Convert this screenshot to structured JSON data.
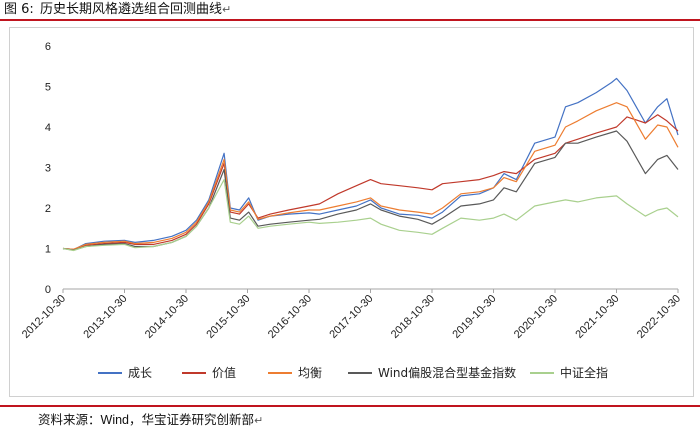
{
  "caption": {
    "label": "图 6:",
    "title": "历史长期风格遴选组合回测曲线",
    "return_mark": "↵"
  },
  "source": {
    "prefix": "资料来源：",
    "wind": "Wind",
    "sep": "，",
    "org": "华宝证券研究创新部",
    "return_mark": "↵"
  },
  "chart_data": {
    "type": "line",
    "y_ticks": [
      "0",
      "1",
      "2",
      "3",
      "4",
      "5",
      "6"
    ],
    "ylim": [
      0,
      6
    ],
    "x_ticks": [
      "2012-10-30",
      "2013-10-30",
      "2014-10-30",
      "2015-10-30",
      "2016-10-30",
      "2017-10-30",
      "2018-10-30",
      "2019-10-30",
      "2020-10-30",
      "2021-10-30",
      "2022-10-30"
    ],
    "xlim": [
      2012.83,
      2022.83
    ],
    "grid": false,
    "legend_position": "bottom",
    "series": [
      {
        "name": "成长",
        "color": "#4472c4",
        "points": [
          [
            2012.83,
            1.0
          ],
          [
            2013.0,
            0.97
          ],
          [
            2013.2,
            1.12
          ],
          [
            2013.5,
            1.18
          ],
          [
            2013.83,
            1.2
          ],
          [
            2014.0,
            1.15
          ],
          [
            2014.3,
            1.2
          ],
          [
            2014.6,
            1.3
          ],
          [
            2014.83,
            1.45
          ],
          [
            2015.0,
            1.7
          ],
          [
            2015.2,
            2.2
          ],
          [
            2015.45,
            3.35
          ],
          [
            2015.55,
            2.0
          ],
          [
            2015.7,
            1.95
          ],
          [
            2015.85,
            2.25
          ],
          [
            2016.0,
            1.7
          ],
          [
            2016.2,
            1.8
          ],
          [
            2016.5,
            1.85
          ],
          [
            2016.83,
            1.88
          ],
          [
            2017.0,
            1.85
          ],
          [
            2017.3,
            1.95
          ],
          [
            2017.6,
            2.05
          ],
          [
            2017.83,
            2.2
          ],
          [
            2018.0,
            2.0
          ],
          [
            2018.3,
            1.85
          ],
          [
            2018.6,
            1.82
          ],
          [
            2018.83,
            1.75
          ],
          [
            2019.0,
            1.9
          ],
          [
            2019.3,
            2.3
          ],
          [
            2019.6,
            2.35
          ],
          [
            2019.83,
            2.5
          ],
          [
            2020.0,
            2.85
          ],
          [
            2020.2,
            2.7
          ],
          [
            2020.5,
            3.6
          ],
          [
            2020.83,
            3.75
          ],
          [
            2021.0,
            4.5
          ],
          [
            2021.2,
            4.6
          ],
          [
            2021.5,
            4.85
          ],
          [
            2021.75,
            5.1
          ],
          [
            2021.83,
            5.2
          ],
          [
            2022.0,
            4.9
          ],
          [
            2022.3,
            4.1
          ],
          [
            2022.5,
            4.5
          ],
          [
            2022.65,
            4.7
          ],
          [
            2022.83,
            3.8
          ]
        ]
      },
      {
        "name": "价值",
        "color": "#c0392b",
        "points": [
          [
            2012.83,
            1.0
          ],
          [
            2013.0,
            0.98
          ],
          [
            2013.2,
            1.08
          ],
          [
            2013.5,
            1.12
          ],
          [
            2013.83,
            1.15
          ],
          [
            2014.0,
            1.1
          ],
          [
            2014.3,
            1.1
          ],
          [
            2014.6,
            1.2
          ],
          [
            2014.83,
            1.35
          ],
          [
            2015.0,
            1.6
          ],
          [
            2015.2,
            2.1
          ],
          [
            2015.45,
            3.1
          ],
          [
            2015.55,
            1.9
          ],
          [
            2015.7,
            1.85
          ],
          [
            2015.85,
            2.1
          ],
          [
            2016.0,
            1.75
          ],
          [
            2016.2,
            1.85
          ],
          [
            2016.5,
            1.95
          ],
          [
            2016.83,
            2.05
          ],
          [
            2017.0,
            2.1
          ],
          [
            2017.3,
            2.35
          ],
          [
            2017.6,
            2.55
          ],
          [
            2017.83,
            2.7
          ],
          [
            2018.0,
            2.6
          ],
          [
            2018.3,
            2.55
          ],
          [
            2018.6,
            2.5
          ],
          [
            2018.83,
            2.45
          ],
          [
            2019.0,
            2.6
          ],
          [
            2019.3,
            2.65
          ],
          [
            2019.6,
            2.7
          ],
          [
            2019.83,
            2.8
          ],
          [
            2020.0,
            2.9
          ],
          [
            2020.2,
            2.85
          ],
          [
            2020.5,
            3.2
          ],
          [
            2020.83,
            3.35
          ],
          [
            2021.0,
            3.6
          ],
          [
            2021.2,
            3.7
          ],
          [
            2021.5,
            3.85
          ],
          [
            2021.83,
            4.0
          ],
          [
            2022.0,
            4.25
          ],
          [
            2022.3,
            4.1
          ],
          [
            2022.5,
            4.3
          ],
          [
            2022.65,
            4.15
          ],
          [
            2022.83,
            3.9
          ]
        ]
      },
      {
        "name": "均衡",
        "color": "#ed7d31",
        "points": [
          [
            2012.83,
            1.0
          ],
          [
            2013.0,
            0.98
          ],
          [
            2013.2,
            1.1
          ],
          [
            2013.5,
            1.15
          ],
          [
            2013.83,
            1.18
          ],
          [
            2014.0,
            1.12
          ],
          [
            2014.3,
            1.15
          ],
          [
            2014.6,
            1.25
          ],
          [
            2014.83,
            1.4
          ],
          [
            2015.0,
            1.65
          ],
          [
            2015.2,
            2.15
          ],
          [
            2015.45,
            3.2
          ],
          [
            2015.55,
            1.95
          ],
          [
            2015.7,
            1.9
          ],
          [
            2015.85,
            2.15
          ],
          [
            2016.0,
            1.72
          ],
          [
            2016.2,
            1.8
          ],
          [
            2016.5,
            1.88
          ],
          [
            2016.83,
            1.95
          ],
          [
            2017.0,
            1.95
          ],
          [
            2017.3,
            2.05
          ],
          [
            2017.6,
            2.15
          ],
          [
            2017.83,
            2.25
          ],
          [
            2018.0,
            2.05
          ],
          [
            2018.3,
            1.95
          ],
          [
            2018.6,
            1.9
          ],
          [
            2018.83,
            1.85
          ],
          [
            2019.0,
            2.0
          ],
          [
            2019.3,
            2.35
          ],
          [
            2019.6,
            2.4
          ],
          [
            2019.83,
            2.5
          ],
          [
            2020.0,
            2.75
          ],
          [
            2020.2,
            2.65
          ],
          [
            2020.5,
            3.4
          ],
          [
            2020.83,
            3.55
          ],
          [
            2021.0,
            4.0
          ],
          [
            2021.2,
            4.15
          ],
          [
            2021.5,
            4.4
          ],
          [
            2021.83,
            4.6
          ],
          [
            2022.0,
            4.5
          ],
          [
            2022.3,
            3.7
          ],
          [
            2022.5,
            4.05
          ],
          [
            2022.65,
            4.0
          ],
          [
            2022.83,
            3.5
          ]
        ]
      },
      {
        "name": "Wind偏股混合型基金指数",
        "color": "#595959",
        "points": [
          [
            2012.83,
            1.0
          ],
          [
            2013.0,
            0.96
          ],
          [
            2013.2,
            1.05
          ],
          [
            2013.5,
            1.1
          ],
          [
            2013.83,
            1.12
          ],
          [
            2014.0,
            1.05
          ],
          [
            2014.3,
            1.05
          ],
          [
            2014.6,
            1.15
          ],
          [
            2014.83,
            1.3
          ],
          [
            2015.0,
            1.55
          ],
          [
            2015.2,
            2.0
          ],
          [
            2015.45,
            2.95
          ],
          [
            2015.55,
            1.75
          ],
          [
            2015.7,
            1.7
          ],
          [
            2015.85,
            1.9
          ],
          [
            2016.0,
            1.55
          ],
          [
            2016.2,
            1.6
          ],
          [
            2016.5,
            1.65
          ],
          [
            2016.83,
            1.7
          ],
          [
            2017.0,
            1.72
          ],
          [
            2017.3,
            1.85
          ],
          [
            2017.6,
            1.95
          ],
          [
            2017.83,
            2.1
          ],
          [
            2018.0,
            1.95
          ],
          [
            2018.3,
            1.8
          ],
          [
            2018.6,
            1.72
          ],
          [
            2018.83,
            1.6
          ],
          [
            2019.0,
            1.75
          ],
          [
            2019.3,
            2.05
          ],
          [
            2019.6,
            2.1
          ],
          [
            2019.83,
            2.2
          ],
          [
            2020.0,
            2.5
          ],
          [
            2020.2,
            2.4
          ],
          [
            2020.5,
            3.1
          ],
          [
            2020.83,
            3.25
          ],
          [
            2021.0,
            3.6
          ],
          [
            2021.2,
            3.6
          ],
          [
            2021.5,
            3.75
          ],
          [
            2021.83,
            3.9
          ],
          [
            2022.0,
            3.65
          ],
          [
            2022.3,
            2.85
          ],
          [
            2022.5,
            3.2
          ],
          [
            2022.65,
            3.3
          ],
          [
            2022.83,
            2.95
          ]
        ]
      },
      {
        "name": "中证全指",
        "color": "#a9d08e",
        "points": [
          [
            2012.83,
            1.0
          ],
          [
            2013.0,
            0.95
          ],
          [
            2013.2,
            1.05
          ],
          [
            2013.5,
            1.08
          ],
          [
            2013.83,
            1.1
          ],
          [
            2014.0,
            1.02
          ],
          [
            2014.3,
            1.05
          ],
          [
            2014.6,
            1.15
          ],
          [
            2014.83,
            1.3
          ],
          [
            2015.0,
            1.55
          ],
          [
            2015.2,
            2.0
          ],
          [
            2015.45,
            2.7
          ],
          [
            2015.55,
            1.65
          ],
          [
            2015.7,
            1.6
          ],
          [
            2015.85,
            1.8
          ],
          [
            2016.0,
            1.5
          ],
          [
            2016.2,
            1.55
          ],
          [
            2016.5,
            1.6
          ],
          [
            2016.83,
            1.65
          ],
          [
            2017.0,
            1.62
          ],
          [
            2017.3,
            1.65
          ],
          [
            2017.6,
            1.7
          ],
          [
            2017.83,
            1.75
          ],
          [
            2018.0,
            1.6
          ],
          [
            2018.3,
            1.45
          ],
          [
            2018.6,
            1.4
          ],
          [
            2018.83,
            1.35
          ],
          [
            2019.0,
            1.5
          ],
          [
            2019.3,
            1.75
          ],
          [
            2019.6,
            1.7
          ],
          [
            2019.83,
            1.75
          ],
          [
            2020.0,
            1.85
          ],
          [
            2020.2,
            1.7
          ],
          [
            2020.5,
            2.05
          ],
          [
            2020.83,
            2.15
          ],
          [
            2021.0,
            2.2
          ],
          [
            2021.2,
            2.15
          ],
          [
            2021.5,
            2.25
          ],
          [
            2021.83,
            2.3
          ],
          [
            2022.0,
            2.1
          ],
          [
            2022.3,
            1.8
          ],
          [
            2022.5,
            1.95
          ],
          [
            2022.65,
            2.0
          ],
          [
            2022.83,
            1.78
          ]
        ]
      }
    ]
  }
}
